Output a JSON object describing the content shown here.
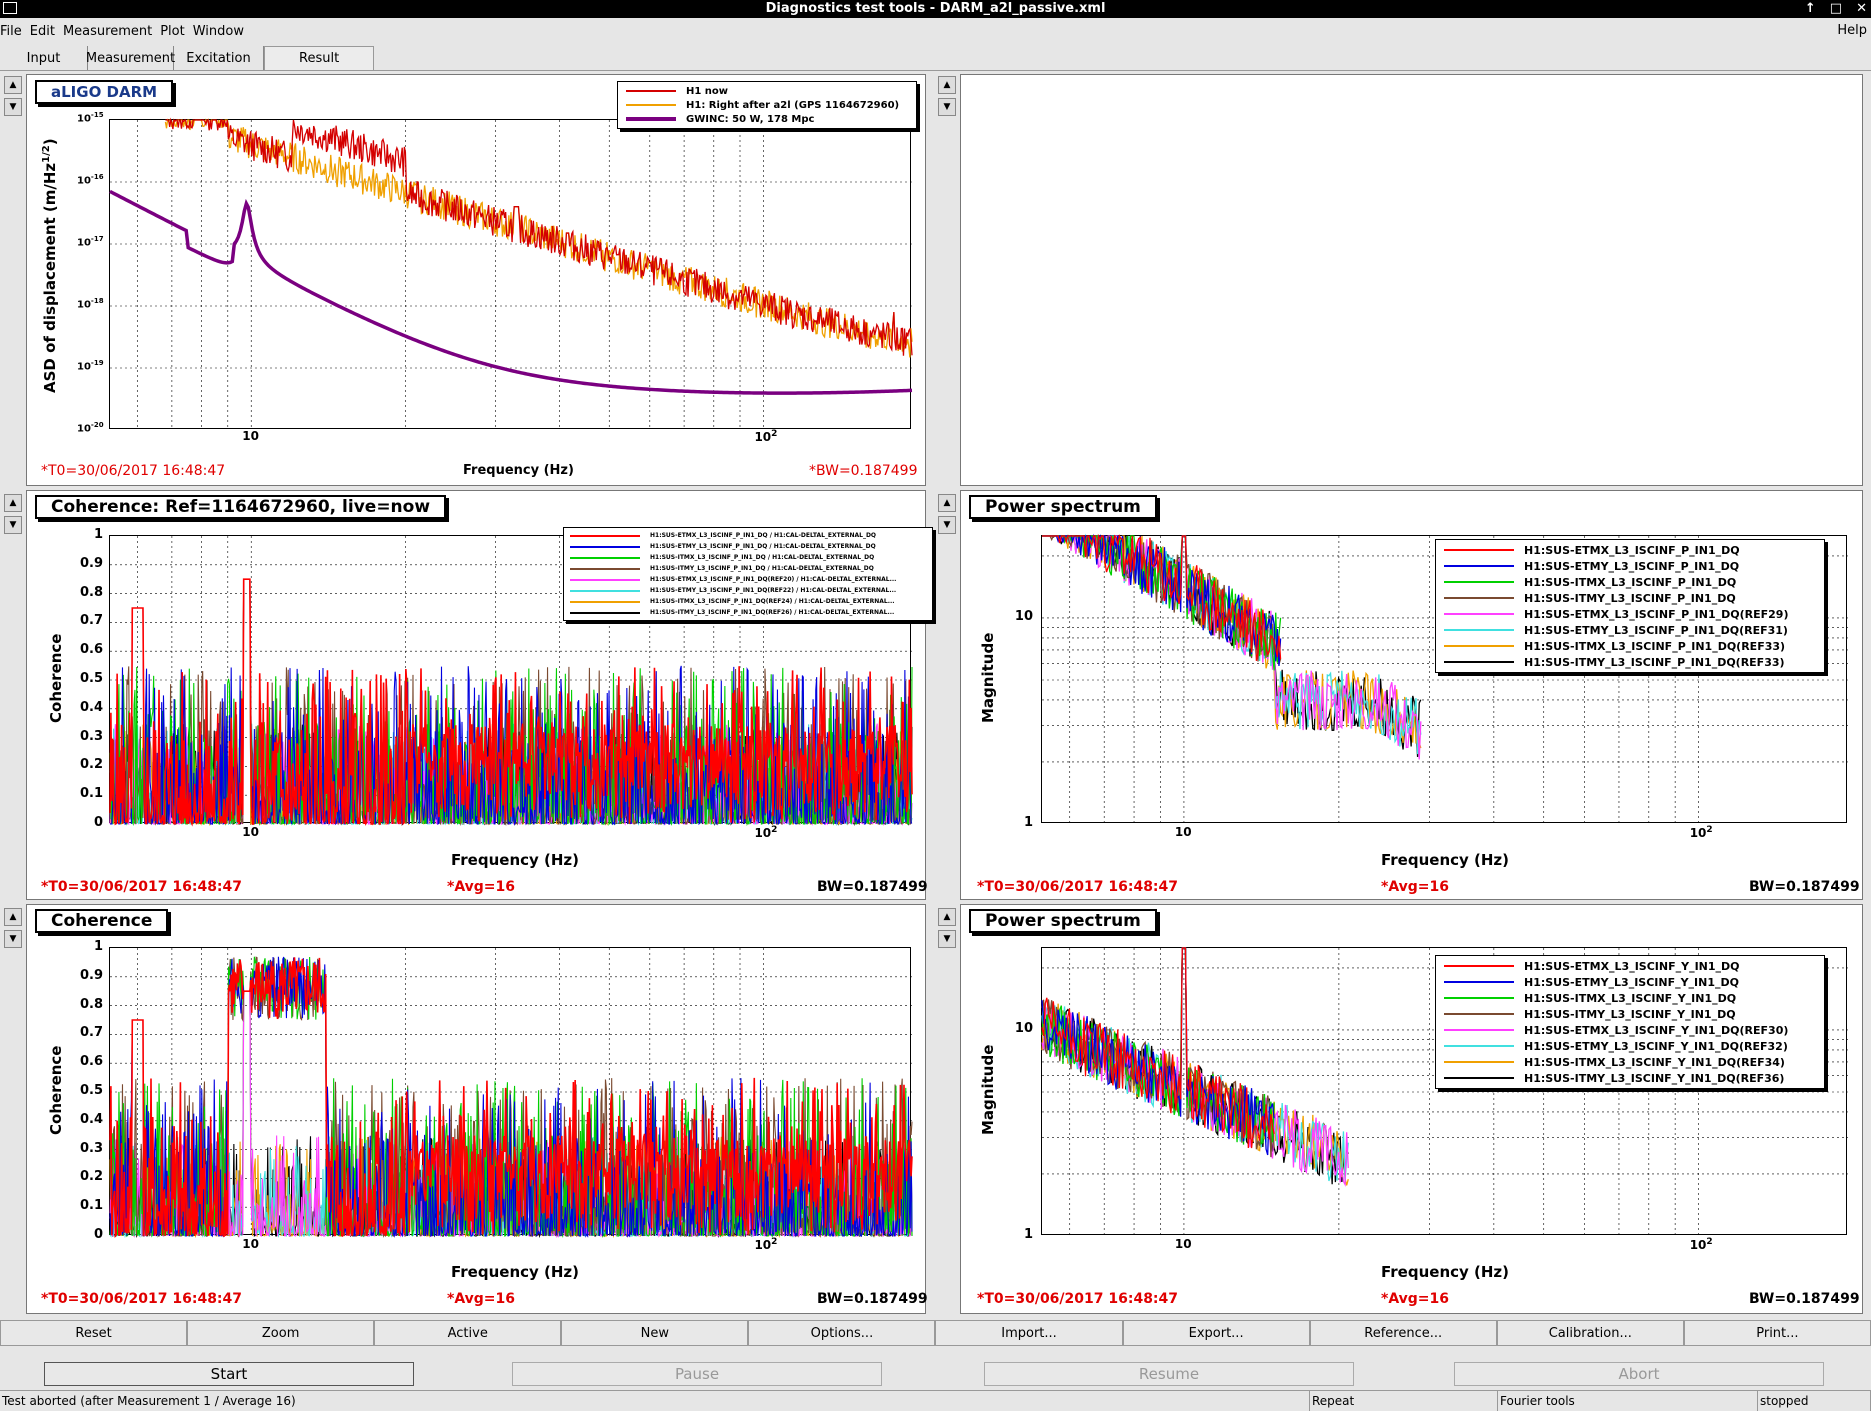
{
  "window": {
    "title": "Diagnostics test tools - DARM_a2l_passive.xml"
  },
  "menu": {
    "file": "File",
    "edit": "Edit",
    "measurement": "Measurement",
    "plot": "Plot",
    "window": "Window",
    "help": "Help"
  },
  "tabs": {
    "input": "Input",
    "measurement": "Measurement",
    "excitation": "Excitation",
    "result": "Result"
  },
  "panels": {
    "darm": {
      "title": "aLIGO DARM",
      "ylabel": "ASD of displacement (m/Hz",
      "ylabel_sup": "1/2",
      "ylabel_end": ")",
      "xlabel": "Frequency (Hz)",
      "t0": "*T0=30/06/2017 16:48:47",
      "bw": "*BW=0.187499",
      "yticks": [
        "10",
        "10",
        "10",
        "10",
        "10",
        "10"
      ],
      "yexp": [
        "-15",
        "-16",
        "-17",
        "-18",
        "-19",
        "-20"
      ],
      "xticks": [
        "10",
        "10"
      ],
      "xexp": [
        "",
        "2"
      ],
      "legend": [
        "H1 now",
        "H1: Right after a2l (GPS 1164672960)",
        "GWINC: 50 W, 178 Mpc"
      ],
      "legend_colors": [
        "#d40000",
        "#f0a000",
        "#7a0080"
      ]
    },
    "coh_p": {
      "title": "Coherence: Ref=1164672960, live=now",
      "ylabel": "Coherence",
      "xlabel": "Frequency (Hz)",
      "t0": "*T0=30/06/2017 16:48:47",
      "avg": "*Avg=16",
      "bw": "BW=0.187499",
      "yticks": [
        "1",
        "0.9",
        "0.8",
        "0.7",
        "0.6",
        "0.5",
        "0.4",
        "0.3",
        "0.2",
        "0.1",
        "0"
      ],
      "xticks": [
        "10",
        "10"
      ],
      "xexp": [
        "",
        "2"
      ],
      "legend": [
        "H1:SUS-ETMX_L3_ISCINF_P_IN1_DQ / H1:CAL-DELTAL_EXTERNAL_DQ",
        "H1:SUS-ETMY_L3_ISCINF_P_IN1_DQ / H1:CAL-DELTAL_EXTERNAL_DQ",
        "H1:SUS-ITMX_L3_ISCINF_P_IN1_DQ / H1:CAL-DELTAL_EXTERNAL_DQ",
        "H1:SUS-ITMY_L3_ISCINF_P_IN1_DQ / H1:CAL-DELTAL_EXTERNAL_DQ",
        "H1:SUS-ETMX_L3_ISCINF_P_IN1_DQ(REF20) / H1:CAL-DELTAL_EXTERNAL...",
        "H1:SUS-ETMY_L3_ISCINF_P_IN1_DQ(REF22) / H1:CAL-DELTAL_EXTERNAL...",
        "H1:SUS-ITMX_L3_ISCINF_P_IN1_DQ(REF24) / H1:CAL-DELTAL_EXTERNAL...",
        "H1:SUS-ITMY_L3_ISCINF_P_IN1_DQ(REF26) / H1:CAL-DELTAL_EXTERNAL..."
      ]
    },
    "ps_p": {
      "title": "Power spectrum",
      "ylabel": "Magnitude",
      "xlabel": "Frequency (Hz)",
      "t0": "*T0=30/06/2017 16:48:47",
      "avg": "*Avg=16",
      "bw": "BW=0.187499",
      "yticks": [
        "10",
        "1"
      ],
      "xticks": [
        "10",
        "10"
      ],
      "xexp": [
        "",
        "2"
      ],
      "legend": [
        "H1:SUS-ETMX_L3_ISCINF_P_IN1_DQ",
        "H1:SUS-ETMY_L3_ISCINF_P_IN1_DQ",
        "H1:SUS-ITMX_L3_ISCINF_P_IN1_DQ",
        "H1:SUS-ITMY_L3_ISCINF_P_IN1_DQ",
        "H1:SUS-ETMX_L3_ISCINF_P_IN1_DQ(REF29)",
        "H1:SUS-ETMY_L3_ISCINF_P_IN1_DQ(REF31)",
        "H1:SUS-ITMX_L3_ISCINF_P_IN1_DQ(REF33)",
        "H1:SUS-ITMY_L3_ISCINF_P_IN1_DQ(REF33)"
      ]
    },
    "coh_y": {
      "title": "Coherence",
      "ylabel": "Coherence",
      "xlabel": "Frequency (Hz)",
      "t0": "*T0=30/06/2017 16:48:47",
      "avg": "*Avg=16",
      "bw": "BW=0.187499",
      "yticks": [
        "1",
        "0.9",
        "0.8",
        "0.7",
        "0.6",
        "0.5",
        "0.4",
        "0.3",
        "0.2",
        "0.1",
        "0"
      ],
      "xticks": [
        "10",
        "10"
      ],
      "xexp": [
        "",
        "2"
      ]
    },
    "ps_y": {
      "title": "Power spectrum",
      "ylabel": "Magnitude",
      "xlabel": "Frequency (Hz)",
      "t0": "*T0=30/06/2017 16:48:47",
      "avg": "*Avg=16",
      "bw": "BW=0.187499",
      "yticks": [
        "10",
        "1"
      ],
      "xticks": [
        "10",
        "10"
      ],
      "xexp": [
        "",
        "2"
      ],
      "legend": [
        "H1:SUS-ETMX_L3_ISCINF_Y_IN1_DQ",
        "H1:SUS-ETMY_L3_ISCINF_Y_IN1_DQ",
        "H1:SUS-ITMX_L3_ISCINF_Y_IN1_DQ",
        "H1:SUS-ITMY_L3_ISCINF_Y_IN1_DQ",
        "H1:SUS-ETMX_L3_ISCINF_Y_IN1_DQ(REF30)",
        "H1:SUS-ETMY_L3_ISCINF_Y_IN1_DQ(REF32)",
        "H1:SUS-ITMX_L3_ISCINF_Y_IN1_DQ(REF34)",
        "H1:SUS-ITMY_L3_ISCINF_Y_IN1_DQ(REF36)"
      ]
    }
  },
  "series_colors": [
    "#ff0000",
    "#0000e0",
    "#00d000",
    "#7a4a30",
    "#ff40ff",
    "#40e0e0",
    "#f0a000",
    "#000000"
  ],
  "buttons": [
    "Reset",
    "Zoom",
    "Active",
    "New",
    "Options...",
    "Import...",
    "Export...",
    "Reference...",
    "Calibration...",
    "Print..."
  ],
  "controls": {
    "start": "Start",
    "pause": "Pause",
    "resume": "Resume",
    "abort": "Abort"
  },
  "status": {
    "message": "Test aborted (after Measurement 1 / Average 16)",
    "repeat": "Repeat",
    "tools": "Fourier tools",
    "state": "stopped"
  }
}
